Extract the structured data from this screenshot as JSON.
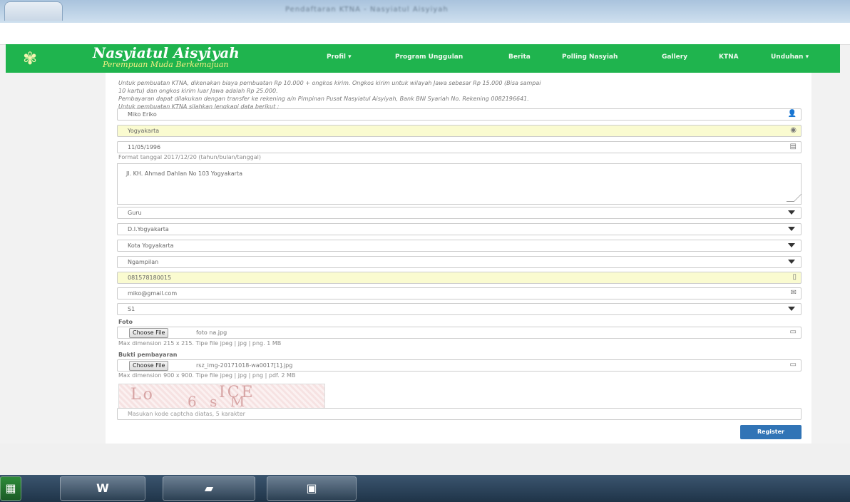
{
  "browser": {
    "title": "Pendaftaran KTNA - Nasyiatul Aisyiyah"
  },
  "navbar": {
    "brand": "Nasyiatul Aisyiyah",
    "brand_sub": "Perempuan Muda Berkemajuan",
    "items": [
      {
        "label": "Profil  ▾"
      },
      {
        "label": "Program Unggulan"
      },
      {
        "label": "Berita"
      },
      {
        "label": "Polling Nasyiah"
      },
      {
        "label": "Gallery"
      },
      {
        "label": "KTNA"
      },
      {
        "label": "Unduhan  ▾"
      }
    ]
  },
  "intro": {
    "line1": "Untuk pembuatan KTNA, dikenakan biaya pembuatan Rp 10.000 + ongkos kirim. Ongkos kirim untuk wilayah Jawa sebesar Rp 15.000 (Bisa sampai",
    "line2": "10 kartu) dan ongkos kirim luar Jawa adalah Rp 25.000.",
    "line3": "Pembayaran dapat dilakukan dengan transfer ke rekening a/n Pimpinan Pusat Nasyiatul Aisyiyah, Bank BNI Syariah No. Rekening 0082196641.",
    "line4": "Untuk pembuatan KTNA silahkan lengkapi data berikut :"
  },
  "form": {
    "name": "Miko Eriko",
    "birth_place": "Yogyakarta",
    "birth_date": "11/05/1996",
    "date_help": "Format tanggal 2017/12/20 (tahun/bulan/tanggal)",
    "address": "Jl. KH. Ahmad Dahlan No 103 Yogyakarta",
    "job": "Guru",
    "province": "D.I.Yogyakarta",
    "city": "Kota Yogyakarta",
    "district": "Ngampilan",
    "phone": "081578180015",
    "email": "miko@gmail.com",
    "education": "S1",
    "photo_label": "Foto",
    "photo_button": "Choose File",
    "photo_file": "foto na.jpg",
    "photo_help": "Max dimension 215 x 215. Tipe file jpeg | jpg | png. 1 MB",
    "proof_label": "Bukti pembayaran",
    "proof_button": "Choose File",
    "proof_file": "rsz_img-20171018-wa0017[1].jpg",
    "proof_help": "Max dimension 900 x 900. Tipe file jpeg | jpg | png | pdf. 2 MB",
    "captcha_placeholder": "Masukan kode captcha diatas, 5 karakter",
    "register": "Register"
  },
  "taskbar": {
    "items": [
      "excel-icon",
      "word-icon",
      "folder-icon",
      "control-panel-icon"
    ]
  }
}
